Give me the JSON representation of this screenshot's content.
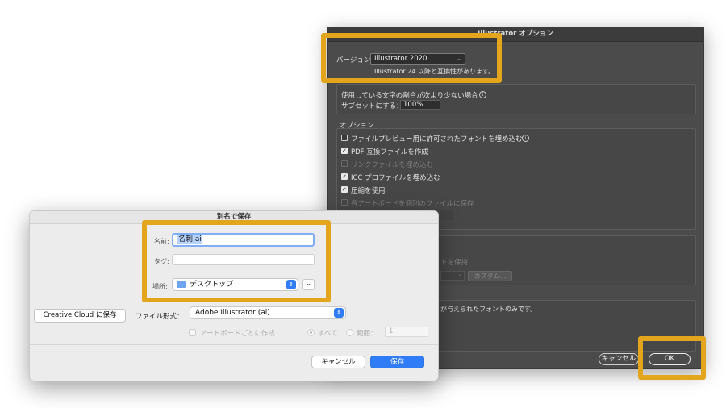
{
  "illustrator_options": {
    "title": "Illustrator オプション",
    "version_label": "バージョン",
    "version_value": "Illustrator 2020",
    "version_note": "Illustrator 24 以降と互換性があります。",
    "font_subset_condition": "使用している文字の割合が次より少ない場合",
    "subset_label": "サブセットにする：",
    "subset_value": "100%",
    "options_heading": "オプション",
    "options": [
      {
        "label": "ファイルプレビュー用に許可されたフォントを埋め込む",
        "checked": false,
        "enabled": true
      },
      {
        "label": "PDF 互換ファイルを作成",
        "checked": true,
        "enabled": true
      },
      {
        "label": "リンクファイルを埋め込む",
        "checked": false,
        "enabled": false
      },
      {
        "label": "ICC プロファイルを埋め込む",
        "checked": true,
        "enabled": true
      },
      {
        "label": "圧縮を使用",
        "checked": true,
        "enabled": true
      },
      {
        "label": "各アートボードを個別のファイルに保存",
        "checked": false,
        "enabled": false
      }
    ],
    "transparency_partial": "トを保持",
    "custom_button": "カスタム...",
    "warning_partial": "が与えられたフォントのみです。",
    "cancel_button": "キャンセル",
    "ok_button": "OK"
  },
  "save_dialog": {
    "title": "別名で保存",
    "name_label": "名前:",
    "name_value": "名刺.ai",
    "tags_label": "タグ:",
    "tags_value": "",
    "location_label": "場所:",
    "location_value": "デスクトップ",
    "creative_cloud_button": "Creative Cloud に保存",
    "format_label": "ファイル形式：",
    "format_value": "Adobe Illustrator (ai)",
    "per_artboard_label": "アートボードごとに作成",
    "all_label": "すべて",
    "range_label": "範囲：",
    "range_value": "1",
    "cancel_button": "キャンセル",
    "save_button": "保存"
  },
  "colors": {
    "highlight": "#e3a51c",
    "primary_blue": "#2f7cf6",
    "dark_panel": "#4b4b4b"
  }
}
